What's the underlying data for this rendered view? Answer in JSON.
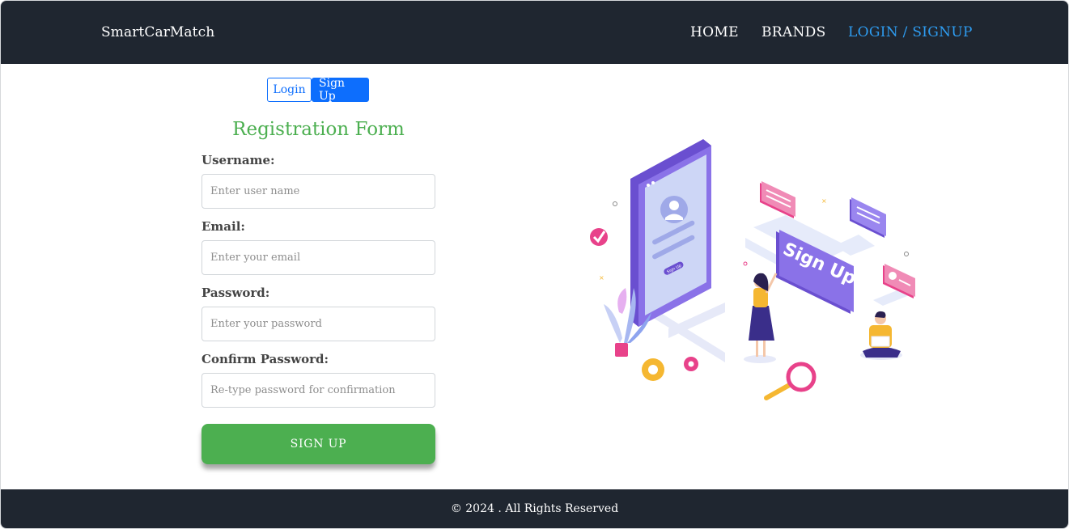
{
  "nav": {
    "brand": "SmartCarMatch",
    "links": [
      {
        "label": "HOME"
      },
      {
        "label": "BRANDS"
      },
      {
        "label": "LOGIN / SIGNUP"
      }
    ]
  },
  "auth_toggle": {
    "login_label": "Login",
    "signup_label": "Sign Up"
  },
  "form": {
    "title": "Registration Form",
    "fields": [
      {
        "label": "Username:",
        "placeholder": "Enter user name",
        "value": ""
      },
      {
        "label": "Email:",
        "placeholder": "Enter your email",
        "value": ""
      },
      {
        "label": "Password:",
        "placeholder": "Enter your password",
        "value": ""
      },
      {
        "label": "Confirm Password:",
        "placeholder": "Re-type password for confirmation",
        "value": ""
      }
    ],
    "submit_label": "SIGN UP"
  },
  "illustration": {
    "sign_label": "Sign Up",
    "phone_button_label": "Sign Up"
  },
  "footer": {
    "text": "© 2024 . All Rights Reserved"
  },
  "colors": {
    "navbar_bg": "#1f2630",
    "active_link": "#2e9cf0",
    "primary": "#0d6efd",
    "success": "#4caf50"
  }
}
